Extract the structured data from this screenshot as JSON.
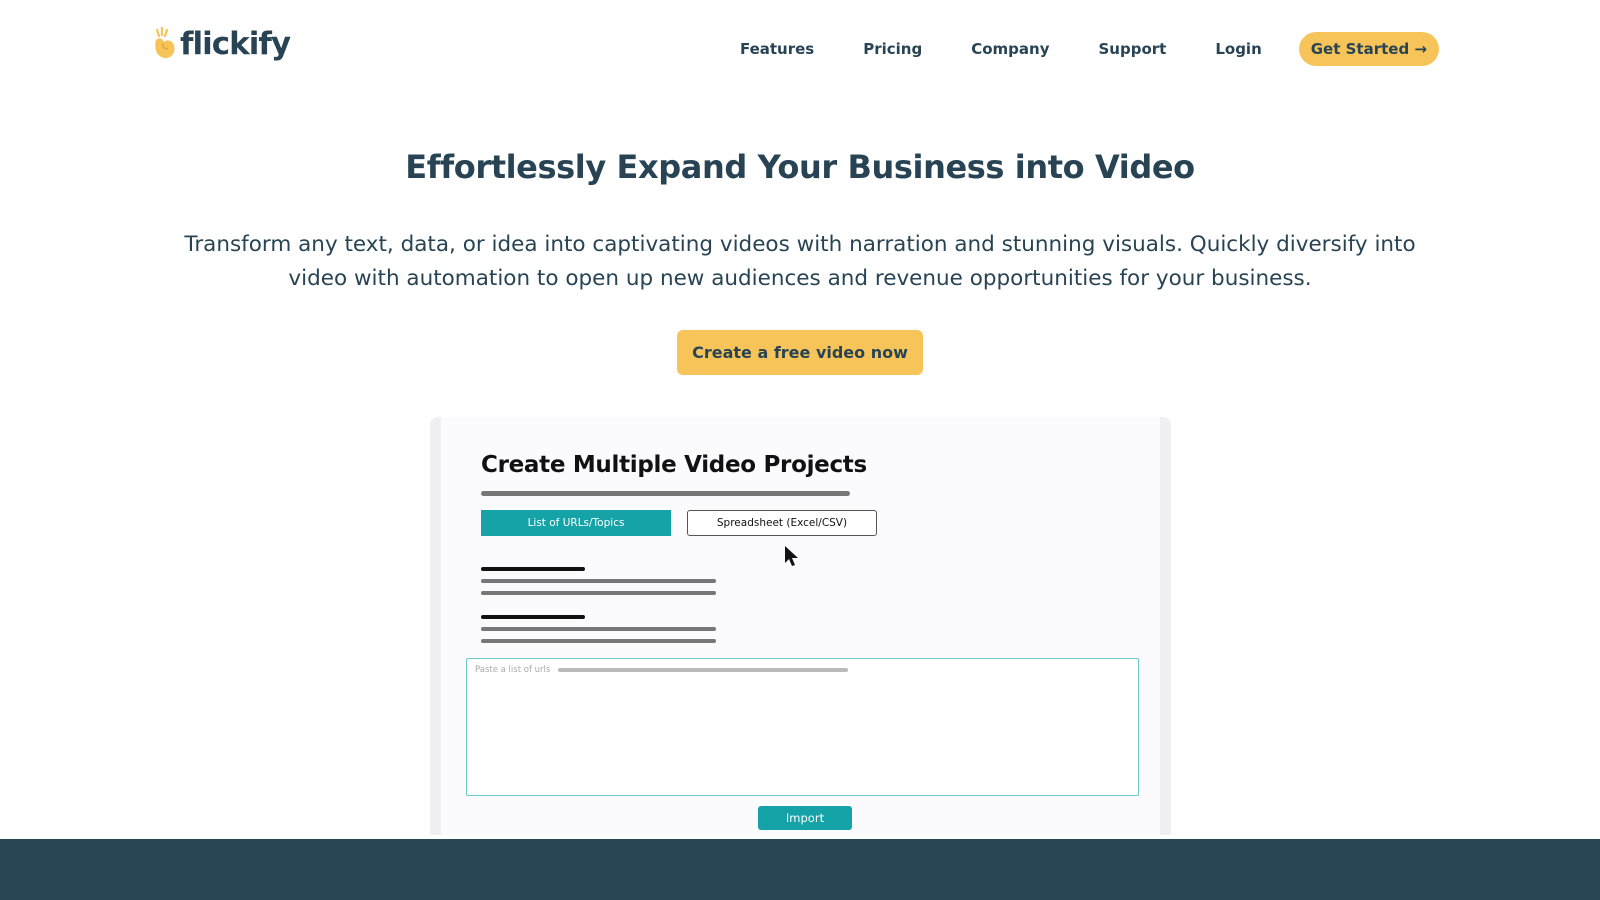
{
  "brand": {
    "name": "flickify",
    "logo_icon": "flame-hand-icon",
    "accent_color": "#f6c458",
    "text_color": "#284454"
  },
  "nav": {
    "items": [
      {
        "label": "Features"
      },
      {
        "label": "Pricing"
      },
      {
        "label": "Company"
      },
      {
        "label": "Support"
      },
      {
        "label": "Login"
      }
    ],
    "cta_label": "Get Started →"
  },
  "hero": {
    "title": "Effortlessly Expand Your Business into Video",
    "subtitle": "Transform any text, data, or idea into captivating videos with narration and stunning visuals.  Quickly diversify into video with automation to open up new audiences and revenue opportunities for your business.",
    "cta_label": "Create a free video now"
  },
  "mockup": {
    "title": "Create Multiple Video Projects",
    "tabs": [
      {
        "label": "List of URLs/Topics",
        "active": true
      },
      {
        "label": "Spreadsheet (Excel/CSV)",
        "active": false
      }
    ],
    "url_placeholder": "Paste a list of urls",
    "import_label": "Import",
    "teal_color": "#15a3a8"
  },
  "footer": {
    "band_color": "#284654"
  }
}
